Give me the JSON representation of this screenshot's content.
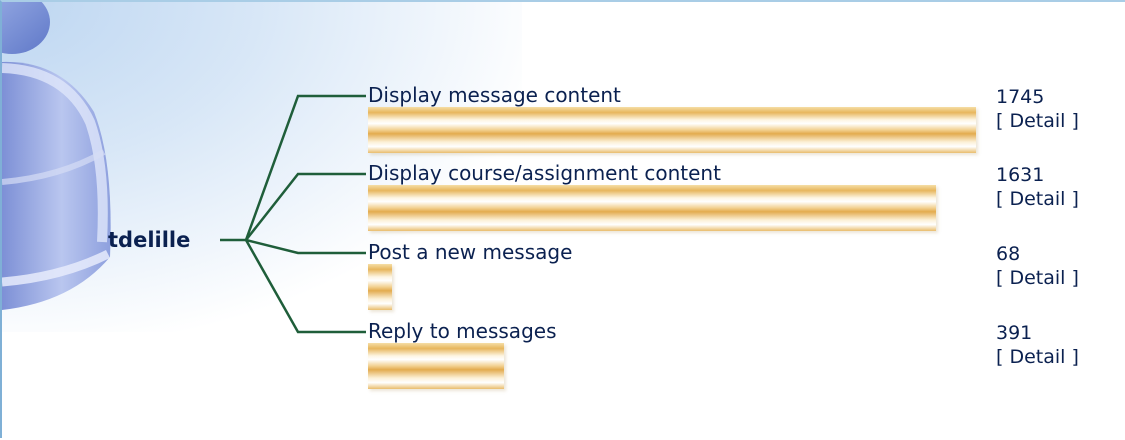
{
  "chart_data": {
    "type": "bar",
    "orientation": "horizontal",
    "root_label": "tdelille",
    "categories": [
      "Display message content",
      "Display course/assignment content",
      "Post a new message",
      "Reply to messages"
    ],
    "values": [
      1745,
      1631,
      68,
      391
    ],
    "link_label": "[ Detail ]"
  },
  "colors": {
    "bar": "#e7b65d",
    "text": "#0b2150",
    "connector": "#1f5e3a",
    "frame": "#7fb0d6"
  },
  "icons": [
    "user-avatar-icon"
  ]
}
